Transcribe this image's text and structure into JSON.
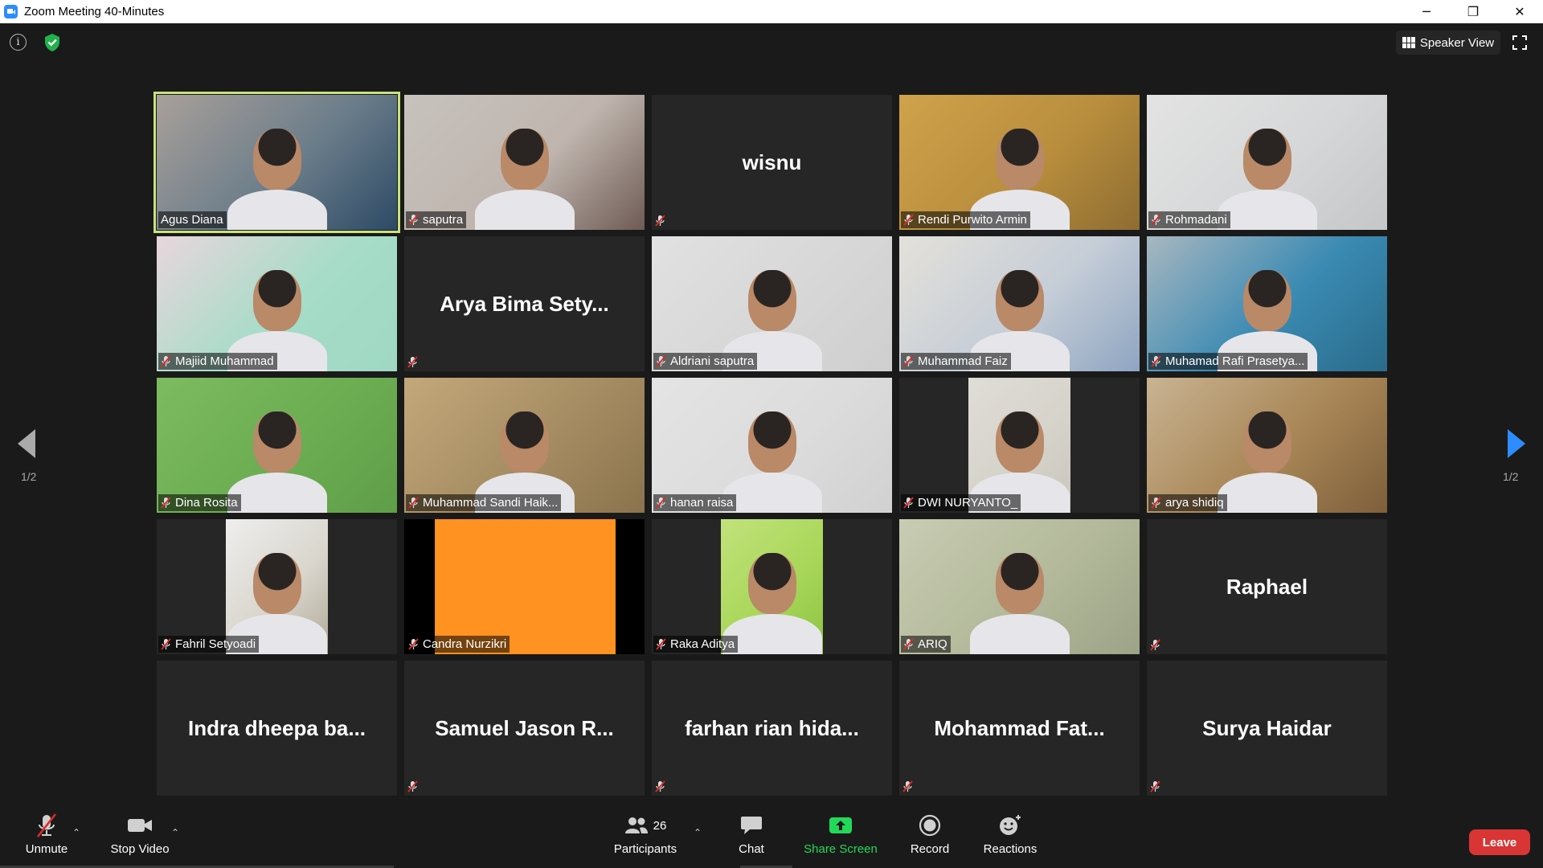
{
  "window": {
    "title": "Zoom Meeting 40-Minutes",
    "controls": [
      "─",
      "❐",
      "✕"
    ]
  },
  "header": {
    "speaker_view_label": "Speaker View"
  },
  "pagination": {
    "left": "1/2",
    "right": "1/2"
  },
  "participants": [
    {
      "name": "Agus Diana",
      "video": "full",
      "muted": false,
      "active": true,
      "colors": [
        "#6b7d8a",
        "#2d4a66",
        "#a9a09a"
      ]
    },
    {
      "name": "saputra",
      "video": "full",
      "muted": true,
      "colors": [
        "#bfb5ae",
        "#6f5a55",
        "#c7c2bd"
      ]
    },
    {
      "name": "wisnu",
      "video": "none",
      "muted": true
    },
    {
      "name": "Rendi Purwito Armin",
      "video": "full",
      "muted": true,
      "colors": [
        "#b98e3d",
        "#8e6d32",
        "#cfa24b"
      ]
    },
    {
      "name": "Rohmadani",
      "video": "full",
      "muted": true,
      "colors": [
        "#d6d7d8",
        "#c5c6c8",
        "#e3e3e3"
      ]
    },
    {
      "name": "Majiid Muhammad",
      "video": "full",
      "muted": true,
      "colors": [
        "#a6dcc8",
        "#9fd8c3",
        "#e8d6dc"
      ]
    },
    {
      "name": "Arya Bima Sety...",
      "video": "none",
      "muted": true
    },
    {
      "name": "Aldriani saputra",
      "video": "full",
      "muted": true,
      "colors": [
        "#d7d7d7",
        "#cfcfcf",
        "#e1e1e1"
      ]
    },
    {
      "name": "Muhammad Faiz",
      "video": "full",
      "muted": true,
      "colors": [
        "#c5cdd7",
        "#8fa5c2",
        "#e4e1da"
      ]
    },
    {
      "name": "Muhamad Rafi Prasetya...",
      "video": "full",
      "muted": true,
      "colors": [
        "#3a8ab3",
        "#2a6b8a",
        "#a8b7c0"
      ]
    },
    {
      "name": "Dina Rosita",
      "video": "full",
      "muted": true,
      "colors": [
        "#6cad52",
        "#5f9e48",
        "#7dbb60"
      ]
    },
    {
      "name": "Muhammad Sandi Haik...",
      "video": "full",
      "muted": true,
      "colors": [
        "#a68c62",
        "#8a734d",
        "#c2a87a"
      ]
    },
    {
      "name": "hanan raisa",
      "video": "full",
      "muted": true,
      "colors": [
        "#dcdcdc",
        "#d1d1d1",
        "#e4e4e4"
      ]
    },
    {
      "name": "DWI NURYANTO_",
      "video": "narrow",
      "muted": true,
      "colors": [
        "#d6d3cb",
        "#cac6bd",
        "#e0ddd6"
      ]
    },
    {
      "name": "arya shidiq",
      "video": "full",
      "muted": true,
      "colors": [
        "#a88656",
        "#7e5f3b",
        "#c9b392"
      ]
    },
    {
      "name": "Fahril Setyoadi",
      "video": "narrow",
      "muted": true,
      "colors": [
        "#d9d6cd",
        "#b3aa99",
        "#eeeeee"
      ]
    },
    {
      "name": "Candra Nurzikri",
      "video": "orange",
      "muted": true
    },
    {
      "name": "Raka Aditya",
      "video": "narrow",
      "muted": true,
      "colors": [
        "#a9d75a",
        "#8dc342",
        "#c2e27c"
      ]
    },
    {
      "name": "ARIQ",
      "video": "full",
      "muted": true,
      "colors": [
        "#b3b99a",
        "#9ca387",
        "#c8ccb3"
      ]
    },
    {
      "name": "Raphael",
      "video": "none",
      "muted": true
    },
    {
      "name": "Indra dheepa ba...",
      "video": "none",
      "muted": false
    },
    {
      "name": "Samuel Jason R...",
      "video": "none",
      "muted": true
    },
    {
      "name": "farhan rian hida...",
      "video": "none",
      "muted": true
    },
    {
      "name": "Mohammad Fat...",
      "video": "none",
      "muted": true
    },
    {
      "name": "Surya Haidar",
      "video": "none",
      "muted": true
    }
  ],
  "toolbar": {
    "unmute_label": "Unmute",
    "stop_video_label": "Stop Video",
    "participants_label": "Participants",
    "participants_count": "26",
    "chat_label": "Chat",
    "share_screen_label": "Share Screen",
    "record_label": "Record",
    "reactions_label": "Reactions",
    "leave_label": "Leave",
    "share_color": "#23d959",
    "leave_color": "#d93535"
  }
}
